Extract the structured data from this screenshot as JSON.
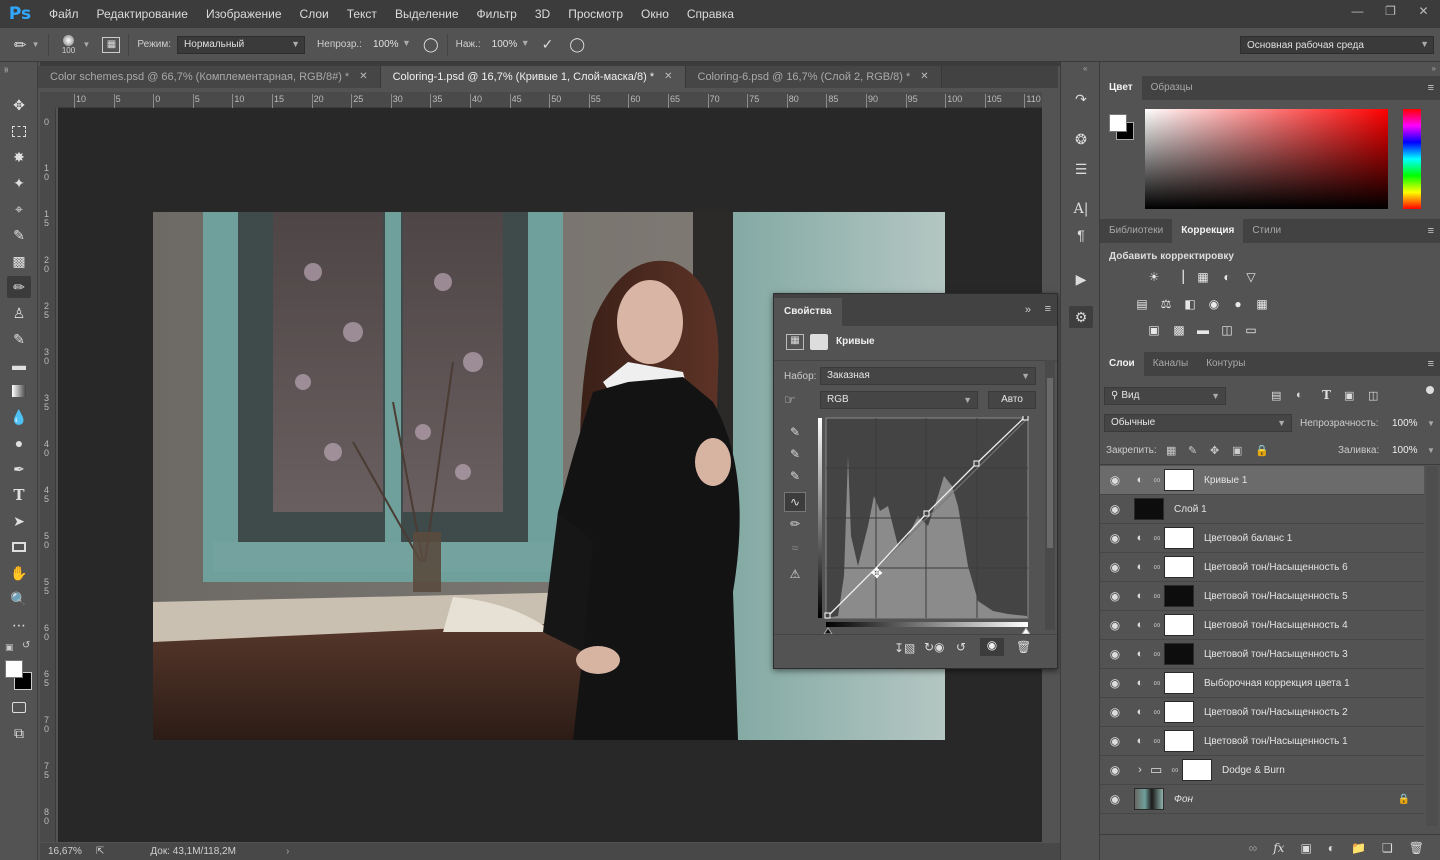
{
  "app": {
    "logo": "Ps"
  },
  "menu": [
    "Файл",
    "Редактирование",
    "Изображение",
    "Слои",
    "Текст",
    "Выделение",
    "Фильтр",
    "3D",
    "Просмотр",
    "Окно",
    "Справка"
  ],
  "options": {
    "brush_size": "100",
    "mode_label": "Режим:",
    "mode_value": "Нормальный",
    "opacity_label": "Непрозр.:",
    "opacity_value": "100%",
    "flow_label": "Наж.:",
    "flow_value": "100%",
    "workspace": "Основная рабочая среда"
  },
  "tabs": [
    {
      "label": "Color schemes.psd @ 66,7% (Комплементарная, RGB/8#) *",
      "active": false
    },
    {
      "label": "Coloring-1.psd @ 16,7% (Кривые 1, Слой-маска/8) *",
      "active": true
    },
    {
      "label": "Coloring-6.psd @ 16,7% (Слой 2, RGB/8) *",
      "active": false
    }
  ],
  "ruler_h": [
    "10",
    "5",
    "0",
    "5",
    "10",
    "15",
    "20",
    "25",
    "30",
    "35",
    "40",
    "45",
    "50",
    "55",
    "60",
    "65",
    "70",
    "75",
    "80",
    "85",
    "90",
    "95",
    "100",
    "105",
    "110"
  ],
  "ruler_v": [
    "0",
    "1 0",
    "1 5",
    "2 0",
    "2 5",
    "3 0",
    "3 5",
    "4 0",
    "4 5",
    "5 0",
    "5 5",
    "6 0",
    "6 5",
    "7 0",
    "7 5",
    "8 0"
  ],
  "status": {
    "zoom": "16,67%",
    "doc": "Док: 43,1M/118,2M"
  },
  "properties": {
    "title": "Свойства",
    "adj_name": "Кривые",
    "preset_label": "Набор:",
    "preset_value": "Заказная",
    "channel": "RGB",
    "auto_button": "Авто"
  },
  "color_panel": {
    "tabs": [
      "Цвет",
      "Образцы"
    ],
    "fg": "#ffffff",
    "bg": "#000000",
    "hue": "#ff0000"
  },
  "adjustments_panel": {
    "tabs": [
      "Библиотеки",
      "Коррекция",
      "Стили"
    ],
    "active": "Коррекция",
    "title": "Добавить корректировку"
  },
  "layers_panel": {
    "tabs": [
      "Слои",
      "Каналы",
      "Контуры"
    ],
    "filter_label": "Вид",
    "blend_mode": "Обычные",
    "opacity_label": "Непрозрачность:",
    "opacity_value": "100%",
    "lock_label": "Закрепить:",
    "fill_label": "Заливка:",
    "fill_value": "100%",
    "layers": [
      {
        "name": "Кривые 1",
        "type": "adj",
        "thumb": "white",
        "selected": true
      },
      {
        "name": "Слой 1",
        "type": "pixel",
        "thumb": "black",
        "selected": false
      },
      {
        "name": "Цветовой баланс 1",
        "type": "adj",
        "thumb": "white",
        "selected": false
      },
      {
        "name": "Цветовой тон/Насыщенность 6",
        "type": "adj",
        "thumb": "white",
        "selected": false
      },
      {
        "name": "Цветовой тон/Насыщенность 5",
        "type": "adj",
        "thumb": "black",
        "selected": false
      },
      {
        "name": "Цветовой тон/Насыщенность 4",
        "type": "adj",
        "thumb": "white",
        "selected": false
      },
      {
        "name": "Цветовой тон/Насыщенность 3",
        "type": "adj",
        "thumb": "black",
        "selected": false
      },
      {
        "name": "Выборочная коррекция цвета 1",
        "type": "adj",
        "thumb": "white",
        "selected": false
      },
      {
        "name": "Цветовой тон/Насыщенность 2",
        "type": "adj",
        "thumb": "white",
        "selected": false
      },
      {
        "name": "Цветовой тон/Насыщенность 1",
        "type": "adj",
        "thumb": "white",
        "selected": false
      },
      {
        "name": "Dodge & Burn",
        "type": "group",
        "thumb": "white",
        "selected": false
      },
      {
        "name": "Фон",
        "type": "bg",
        "thumb": "photo",
        "selected": false
      }
    ]
  }
}
